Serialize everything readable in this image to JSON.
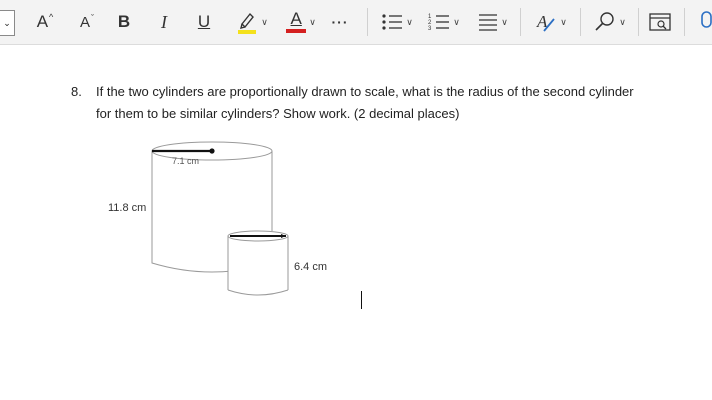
{
  "toolbar": {
    "font_grow_label": "A",
    "font_shrink_label": "A",
    "bold_label": "B",
    "italic_label": "I",
    "underline_label": "U",
    "font_color_label": "A",
    "more_label": "···",
    "highlight_color": "#f4e11c",
    "font_color": "#d42020",
    "icons": [
      "chevron-down-icon",
      "grow-font-icon",
      "shrink-font-icon",
      "bold-icon",
      "italic-icon",
      "underline-icon",
      "highlighter-icon",
      "font-color-icon",
      "more-icon",
      "bullets-icon",
      "numbering-icon",
      "align-icon",
      "styles-icon",
      "search-icon",
      "immersive-reader-icon",
      "dictate-icon"
    ]
  },
  "document": {
    "question_number": "8.",
    "question_line1": "If the two cylinders are proportionally drawn to scale, what is the radius of the second cylinder",
    "question_line2": "for them to be similar cylinders? Show work. (2 decimal places)",
    "figure": {
      "large_radius_label": "7.1 cm",
      "large_height_label": "11.8 cm",
      "small_height_label": "6.4 cm"
    }
  }
}
